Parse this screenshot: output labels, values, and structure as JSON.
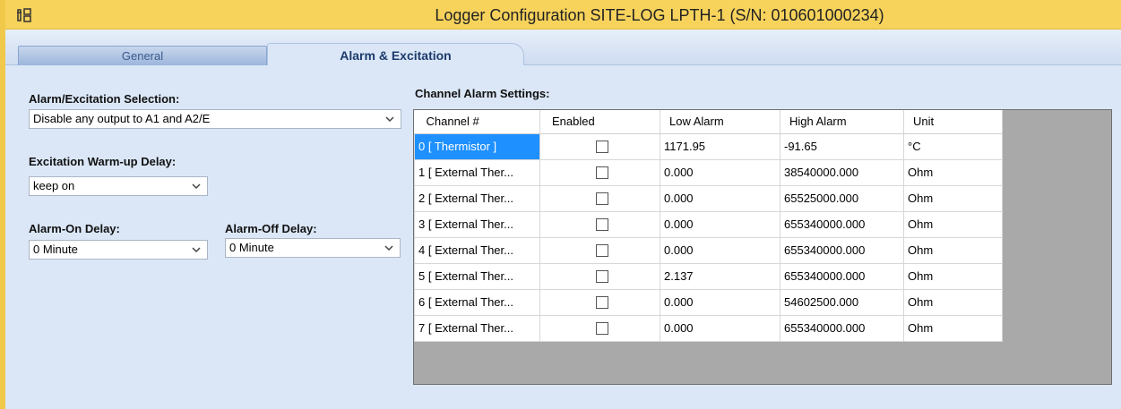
{
  "window": {
    "title": "Logger Configuration SITE-LOG LPTH-1 (S/N: 010601000234)",
    "app_icon": "logger-config-icon"
  },
  "tabs": [
    {
      "label": "General",
      "active": false
    },
    {
      "label": "Alarm & Excitation",
      "active": true
    }
  ],
  "left_panel": {
    "alarm_excitation_label": "Alarm/Excitation Selection:",
    "alarm_excitation_value": "Disable any output to A1 and A2/E",
    "warmup_label": "Excitation Warm-up Delay:",
    "warmup_value": "keep on",
    "alarm_on_label": "Alarm-On Delay:",
    "alarm_on_value": "0 Minute",
    "alarm_off_label": "Alarm-Off Delay:",
    "alarm_off_value": "0 Minute"
  },
  "channel_settings": {
    "label": "Channel Alarm Settings:",
    "columns": [
      "Channel #",
      "Enabled",
      "Low Alarm",
      "High Alarm",
      "Unit"
    ],
    "rows": [
      {
        "channel": "0 [ Thermistor ]",
        "enabled": false,
        "low": "1171.95",
        "high": "-91.65",
        "unit": "°C"
      },
      {
        "channel": "1 [ External Ther...",
        "enabled": false,
        "low": "0.000",
        "high": "38540000.000",
        "unit": "Ohm"
      },
      {
        "channel": "2 [ External Ther...",
        "enabled": false,
        "low": "0.000",
        "high": "65525000.000",
        "unit": "Ohm"
      },
      {
        "channel": "3 [ External Ther...",
        "enabled": false,
        "low": "0.000",
        "high": "655340000.000",
        "unit": "Ohm"
      },
      {
        "channel": "4 [ External Ther...",
        "enabled": false,
        "low": "0.000",
        "high": "655340000.000",
        "unit": "Ohm"
      },
      {
        "channel": "5 [ External Ther...",
        "enabled": false,
        "low": "2.137",
        "high": "655340000.000",
        "unit": "Ohm"
      },
      {
        "channel": "6 [ External Ther...",
        "enabled": false,
        "low": "0.000",
        "high": "54602500.000",
        "unit": "Ohm"
      },
      {
        "channel": "7 [ External Ther...",
        "enabled": false,
        "low": "0.000",
        "high": "655340000.000",
        "unit": "Ohm"
      }
    ]
  }
}
